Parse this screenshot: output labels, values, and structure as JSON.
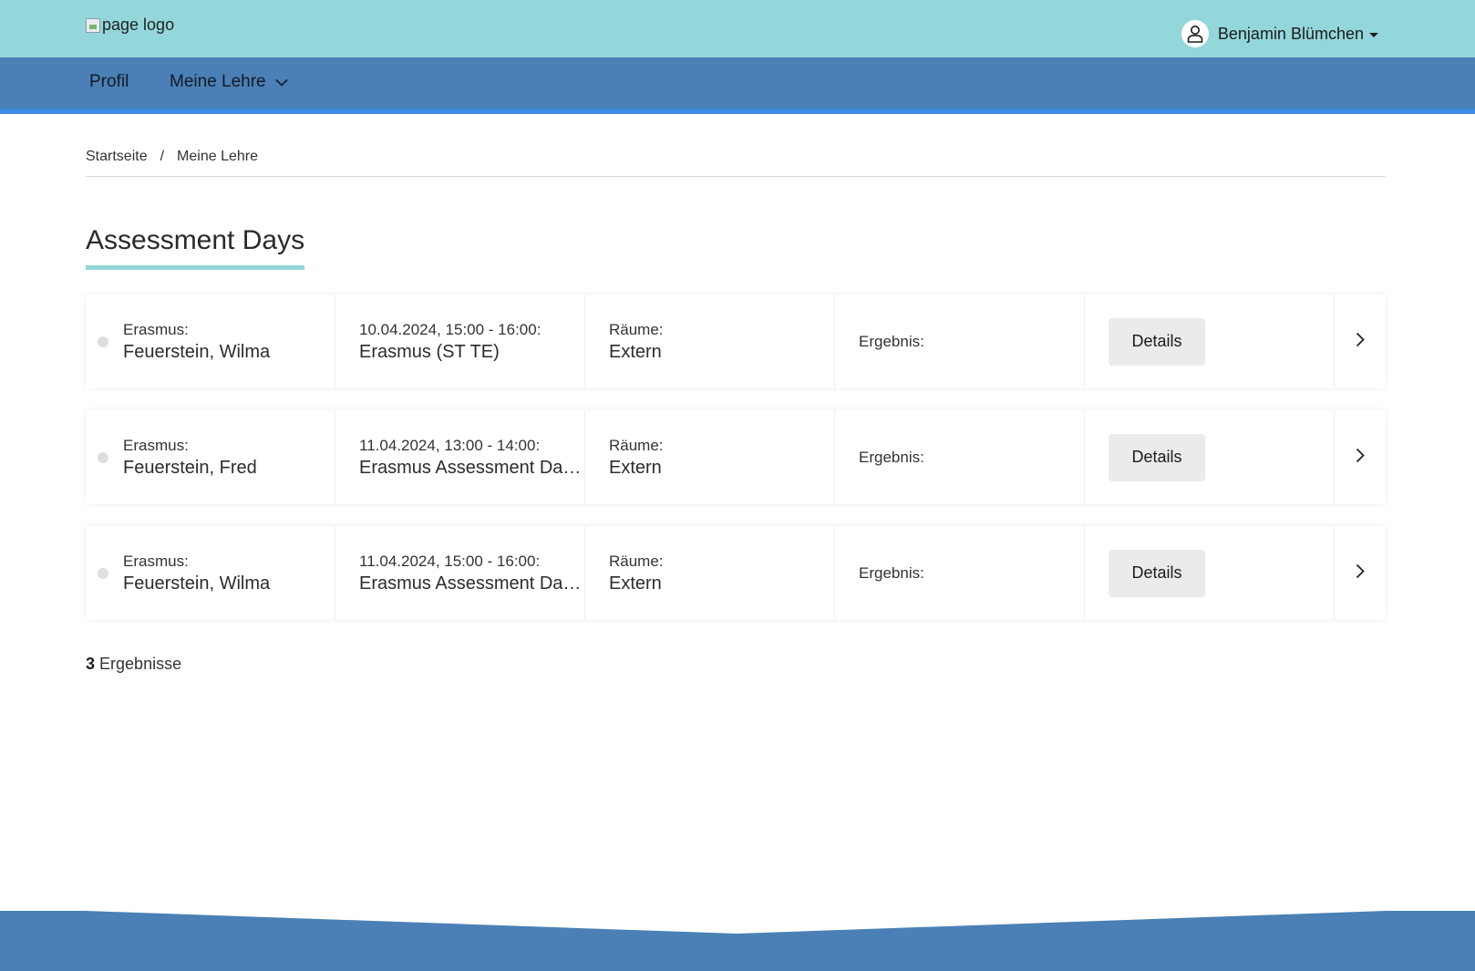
{
  "header": {
    "logo_alt": "page logo",
    "user_name": "Benjamin Blümchen"
  },
  "nav": {
    "profil": "Profil",
    "meine_lehre": "Meine Lehre"
  },
  "breadcrumb": {
    "home": "Startseite",
    "separator": "/",
    "current": "Meine Lehre"
  },
  "page_title": "Assessment Days",
  "rows": [
    {
      "program_label": "Erasmus:",
      "person": "Feuerstein, Wilma",
      "datetime": "10.04.2024, 15:00 - 16:00:",
      "event": "Erasmus (ST TE)",
      "rooms_label": "Räume:",
      "rooms": "Extern",
      "result_label": "Ergebnis:",
      "result": "",
      "details_label": "Details"
    },
    {
      "program_label": "Erasmus:",
      "person": "Feuerstein, Fred",
      "datetime": "11.04.2024, 13:00 - 14:00:",
      "event": "Erasmus Assessment Day...",
      "rooms_label": "Räume:",
      "rooms": "Extern",
      "result_label": "Ergebnis:",
      "result": "",
      "details_label": "Details"
    },
    {
      "program_label": "Erasmus:",
      "person": "Feuerstein, Wilma",
      "datetime": "11.04.2024, 15:00 - 16:00:",
      "event": "Erasmus Assessment Day...",
      "rooms_label": "Räume:",
      "rooms": "Extern",
      "result_label": "Ergebnis:",
      "result": "",
      "details_label": "Details"
    }
  ],
  "results_summary": {
    "count": "3",
    "label": "Ergebnisse"
  },
  "colors": {
    "topbar": "#93d7db",
    "navbar": "#4a80b5",
    "nav_accent": "#3f8be1",
    "footer": "#4a80b5"
  }
}
